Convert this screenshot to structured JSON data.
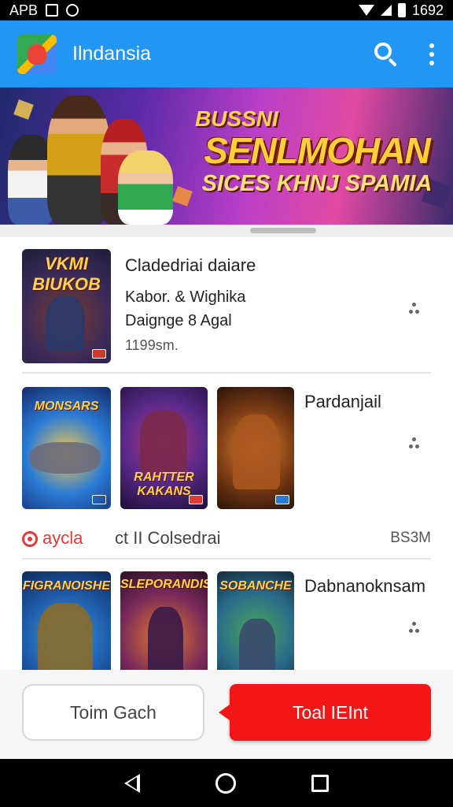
{
  "status_bar": {
    "left_text": "APB",
    "time": "1692"
  },
  "app_bar": {
    "title": "Ilndansia"
  },
  "banner": {
    "pre_title": "BUSSNI",
    "title": "SENLMOHAN",
    "subtitle": "SICES KHNJ SPAMIA"
  },
  "featured": {
    "title": "Cladedriai daiare",
    "line1": "Kabor. & Wighika",
    "line2": "Daignge 8 Agal",
    "meta": "1199sm.",
    "thumb_caption": "VKMI BIUKOB"
  },
  "row1": {
    "title": "Pardanjail",
    "thumbs": [
      {
        "caption": "MONSARS"
      },
      {
        "caption": "RAHTTER KAKANS"
      },
      {
        "caption": ""
      }
    ]
  },
  "section": {
    "label": "aycla",
    "label_rest": "ct II Colsedrai",
    "right": "BS3M"
  },
  "row2": {
    "title": "Dabnanoknsam",
    "thumbs": [
      {
        "caption": "FIGRANOISHE"
      },
      {
        "caption": "SLEPORANDIS"
      },
      {
        "caption": "SOBANCHE"
      }
    ]
  },
  "buttons": {
    "secondary": "Toim Gach",
    "primary": "Toal IEInt"
  },
  "colors": {
    "app_bar": "#2196f3",
    "primary_button": "#f21616",
    "section_accent": "#e53935"
  }
}
